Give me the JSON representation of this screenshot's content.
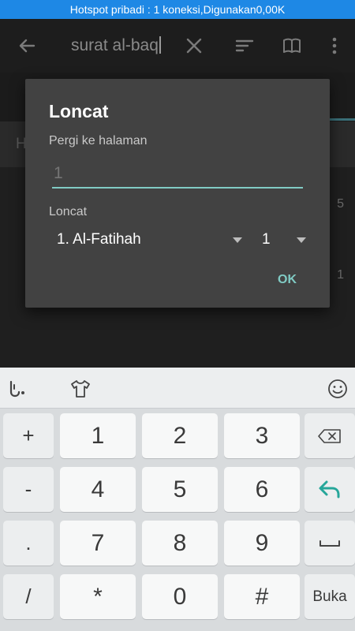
{
  "status_bar": {
    "text": "Hotspot pribadi : 1 koneksi,Digunakan0,00K"
  },
  "search": {
    "query": "surat al-baq"
  },
  "background": {
    "section_header_initial": "H",
    "list_numbers": [
      "5",
      "1"
    ]
  },
  "dialog": {
    "title": "Loncat",
    "page_label": "Pergi ke halaman",
    "page_input_placeholder": "1",
    "jump_label": "Loncat",
    "surah_value": "1. Al-Fatihah",
    "ayah_value": "1",
    "ok_label": "OK"
  },
  "keyboard": {
    "rows": [
      [
        "+",
        "1",
        "2",
        "3",
        "backspace"
      ],
      [
        "-",
        "4",
        "5",
        "6",
        "enter"
      ],
      [
        ".",
        "7",
        "8",
        "9",
        "space"
      ],
      [
        "/",
        "*",
        "0",
        "#",
        "Buka"
      ]
    ],
    "accent_color": "#26a69a"
  }
}
